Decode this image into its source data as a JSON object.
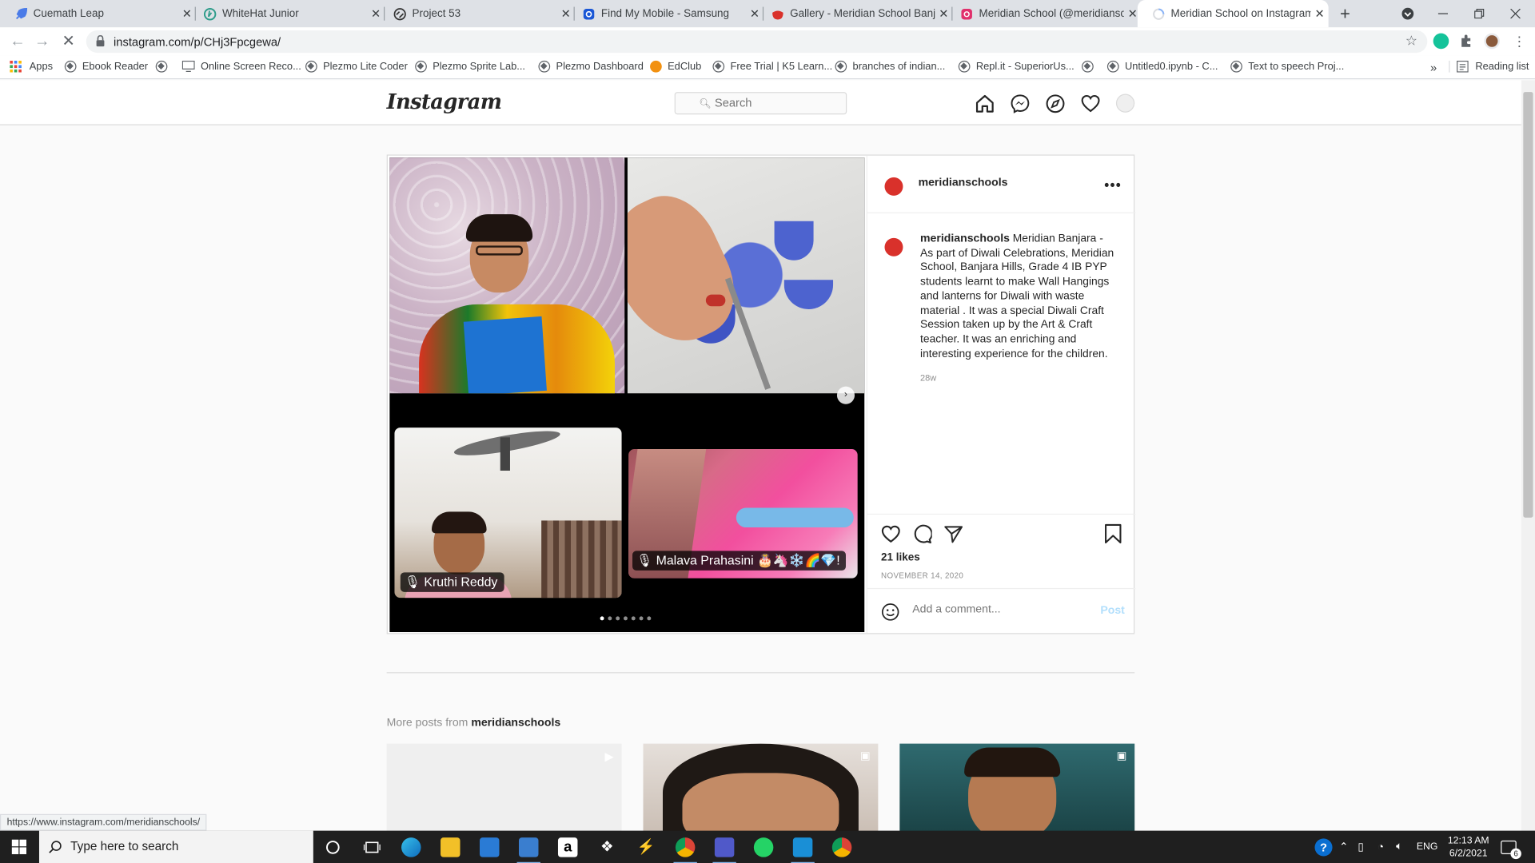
{
  "browser": {
    "tabs": [
      {
        "title": "Cuemath Leap",
        "icon": "rocket-icon",
        "color": "#4a7be8"
      },
      {
        "title": "WhiteHat Junior",
        "icon": "whitehat-icon",
        "color": "#2d9c8a"
      },
      {
        "title": "Project 53",
        "icon": "code-icon",
        "color": "#333333"
      },
      {
        "title": "Find My Mobile - Samsung",
        "icon": "samsung-icon",
        "color": "#1a57d6"
      },
      {
        "title": "Gallery - Meridian School Banjara",
        "icon": "meridian-icon",
        "color": "#d9312b"
      },
      {
        "title": "Meridian School (@meridianschools)",
        "icon": "instagram-icon",
        "color": "#e1306c"
      },
      {
        "title": "Meridian School on Instagram: \"Meridian",
        "icon": "instagram-loading-icon",
        "color": "#8ab4f8"
      }
    ],
    "new_tab": "+",
    "url": "instagram.com/p/CHj3Fpcgewa/",
    "bookmarks": [
      "Apps",
      "Ebook Reader",
      "",
      "Online Screen Reco...",
      "Plezmo Lite Coder",
      "Plezmo Sprite Lab...",
      "Plezmo Dashboard",
      "EdClub",
      "Free Trial | K5 Learn...",
      "branches of indian...",
      "Repl.it - SuperiorUs...",
      "",
      "Untitled0.ipynb - C...",
      "Text to speech Proj..."
    ],
    "bookmarks_overflow": "»",
    "reading_list": "Reading list",
    "status_url": "https://www.instagram.com/meridianschools/"
  },
  "instagram": {
    "logo": "Instagram",
    "search_placeholder": "Search",
    "post": {
      "username": "meridianschools",
      "more": "•••",
      "caption_user": "meridianschools",
      "caption": "Meridian Banjara - As part of Diwali Celebrations, Meridian School, Banjara Hills, Grade 4 IB PYP students learnt to make Wall Hangings and lanterns for Diwali with waste material . It was a special Diwali Craft Session taken up by the Art & Craft teacher. It was an enriching and interesting experience for the children.",
      "age": "28w",
      "likes": "21 likes",
      "date": "NOVEMBER 14, 2020",
      "comment_placeholder": "Add a comment...",
      "post_button": "Post",
      "carousel_dots": 7,
      "carousel_active": 0,
      "name_tags": [
        "Kruthi Reddy",
        "Malava Prahasini"
      ],
      "name_tag_emoji": "🎂🦄❄️🌈💎!"
    },
    "more_posts_prefix": "More posts from",
    "more_posts_user": "meridianschools"
  },
  "taskbar": {
    "search_placeholder": "Type here to search",
    "language": "ENG",
    "time": "12:13 AM",
    "date": "6/2/2021",
    "notifications": "6"
  }
}
